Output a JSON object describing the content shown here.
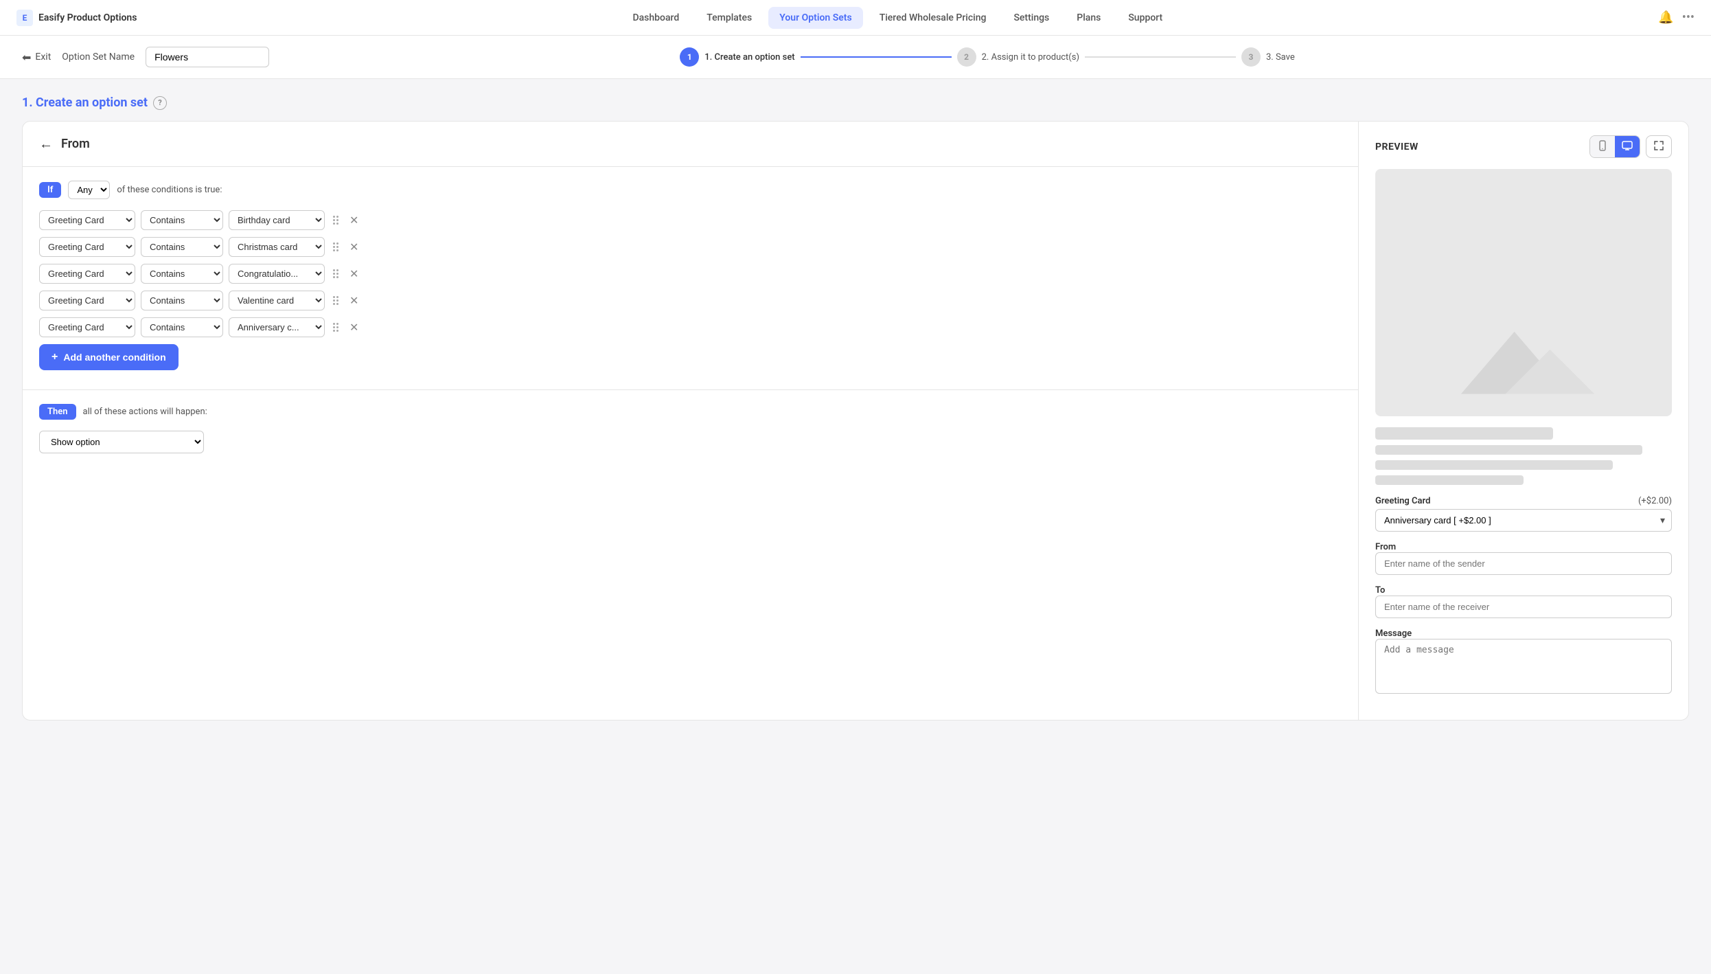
{
  "app": {
    "name": "Easify Product Options",
    "icon_label": "E"
  },
  "nav": {
    "items": [
      {
        "label": "Dashboard",
        "active": false
      },
      {
        "label": "Templates",
        "active": false
      },
      {
        "label": "Your Option Sets",
        "active": true
      },
      {
        "label": "Tiered Wholesale Pricing",
        "active": false
      },
      {
        "label": "Settings",
        "active": false
      },
      {
        "label": "Plans",
        "active": false
      },
      {
        "label": "Support",
        "active": false
      }
    ]
  },
  "wizard": {
    "exit_label": "Exit",
    "set_name_label": "Option Set Name",
    "set_name_value": "Flowers",
    "steps": [
      {
        "number": "1",
        "label": "1. Create an option set",
        "active": true
      },
      {
        "number": "2",
        "label": "2. Assign it to product(s)",
        "active": false
      },
      {
        "number": "3",
        "label": "3. Save",
        "active": false
      }
    ]
  },
  "section_title": "1. Create an option set",
  "panel": {
    "back_label": "From",
    "preview_label": "PREVIEW"
  },
  "conditions": {
    "if_label": "If",
    "any_label": "Any",
    "conditions_text": "of these conditions is true:",
    "rows": [
      {
        "field": "Greeting Card",
        "operator": "Contains",
        "value": "Birthday card"
      },
      {
        "field": "Greeting Card",
        "operator": "Contains",
        "value": "Christmas card"
      },
      {
        "field": "Greeting Card",
        "operator": "Contains",
        "value": "Congratulatio..."
      },
      {
        "field": "Greeting Card",
        "operator": "Contains",
        "value": "Valentine card"
      },
      {
        "field": "Greeting Card",
        "operator": "Contains",
        "value": "Anniversary c..."
      }
    ],
    "add_condition_label": "Add another condition"
  },
  "actions": {
    "then_label": "Then",
    "actions_text": "all of these actions will happen:",
    "action_value": "Show option"
  },
  "preview": {
    "view_mobile_icon": "☐",
    "view_desktop_icon": "⊞",
    "expand_icon": "⤡",
    "skeleton_title_width": "60%",
    "product_form": {
      "greeting_card_label": "Greeting Card",
      "greeting_card_price": "(+$2.00)",
      "greeting_card_value": "Anniversary card [ +$2.00 ]",
      "from_label": "From",
      "from_placeholder": "Enter name of the sender",
      "to_label": "To",
      "to_placeholder": "Enter name of the receiver",
      "message_label": "Message",
      "message_placeholder": "Add a message"
    }
  }
}
